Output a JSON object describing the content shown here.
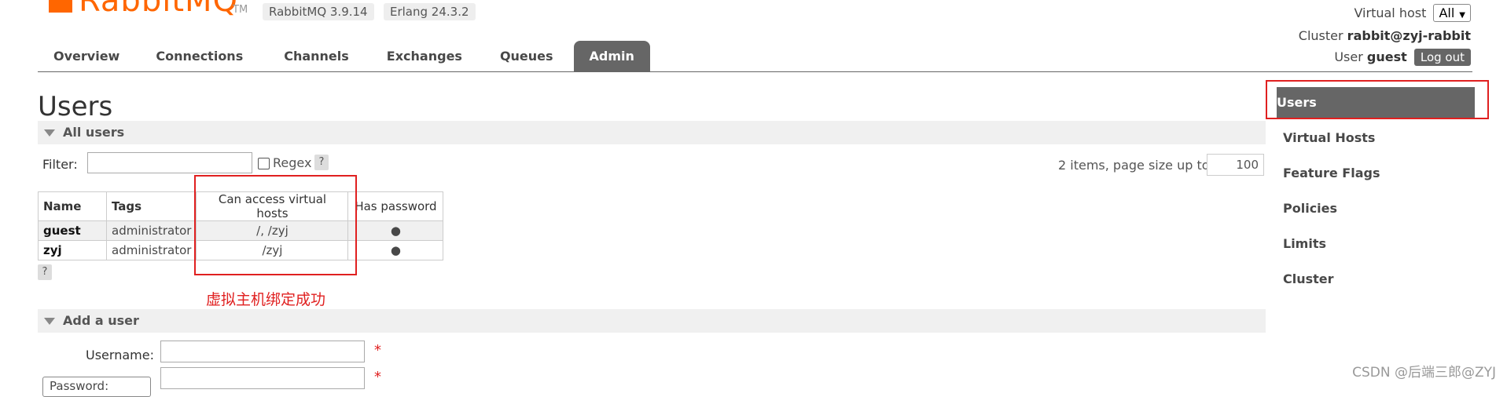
{
  "header": {
    "logo_text": "RabbitMQ",
    "logo_tm": "TM",
    "version_badge": "RabbitMQ 3.9.14",
    "erlang_badge": "Erlang 24.3.2",
    "virtual_host_label": "Virtual host",
    "virtual_host_value": "All",
    "cluster_label": "Cluster",
    "cluster_value": "rabbit@zyj-rabbit",
    "user_label": "User",
    "user_value": "guest",
    "logout_label": "Log out",
    "brand_color": "#ff6600"
  },
  "tabs": [
    {
      "label": "Overview"
    },
    {
      "label": "Connections"
    },
    {
      "label": "Channels"
    },
    {
      "label": "Exchanges"
    },
    {
      "label": "Queues"
    },
    {
      "label": "Admin",
      "active": true
    }
  ],
  "page": {
    "title": "Users"
  },
  "all_users": {
    "section_label": "All users",
    "filter_label": "Filter:",
    "filter_value": "",
    "regex_label": "Regex",
    "help": "?",
    "items_text": "2 items, page size up to",
    "page_size": "100",
    "columns": [
      "Name",
      "Tags",
      "Can access virtual hosts",
      "Has password"
    ],
    "rows": [
      {
        "name": "guest",
        "tags": "administrator",
        "vhosts": "/, /zyj",
        "has_password": "●"
      },
      {
        "name": "zyj",
        "tags": "administrator",
        "vhosts": "/zyj",
        "has_password": "●"
      }
    ],
    "table_help": "?"
  },
  "annotation": {
    "text": "虚拟主机绑定成功",
    "color": "#e02020"
  },
  "add_user": {
    "section_label": "Add a user",
    "username_label": "Username:",
    "username_value": "",
    "password_select": "Password:",
    "password_value": "",
    "required_mark": "*"
  },
  "sidebar": {
    "items": [
      {
        "label": "Users",
        "active": true
      },
      {
        "label": "Virtual Hosts"
      },
      {
        "label": "Feature Flags"
      },
      {
        "label": "Policies"
      },
      {
        "label": "Limits"
      },
      {
        "label": "Cluster"
      }
    ]
  },
  "watermark": "CSDN @后端三郎@ZYJ"
}
